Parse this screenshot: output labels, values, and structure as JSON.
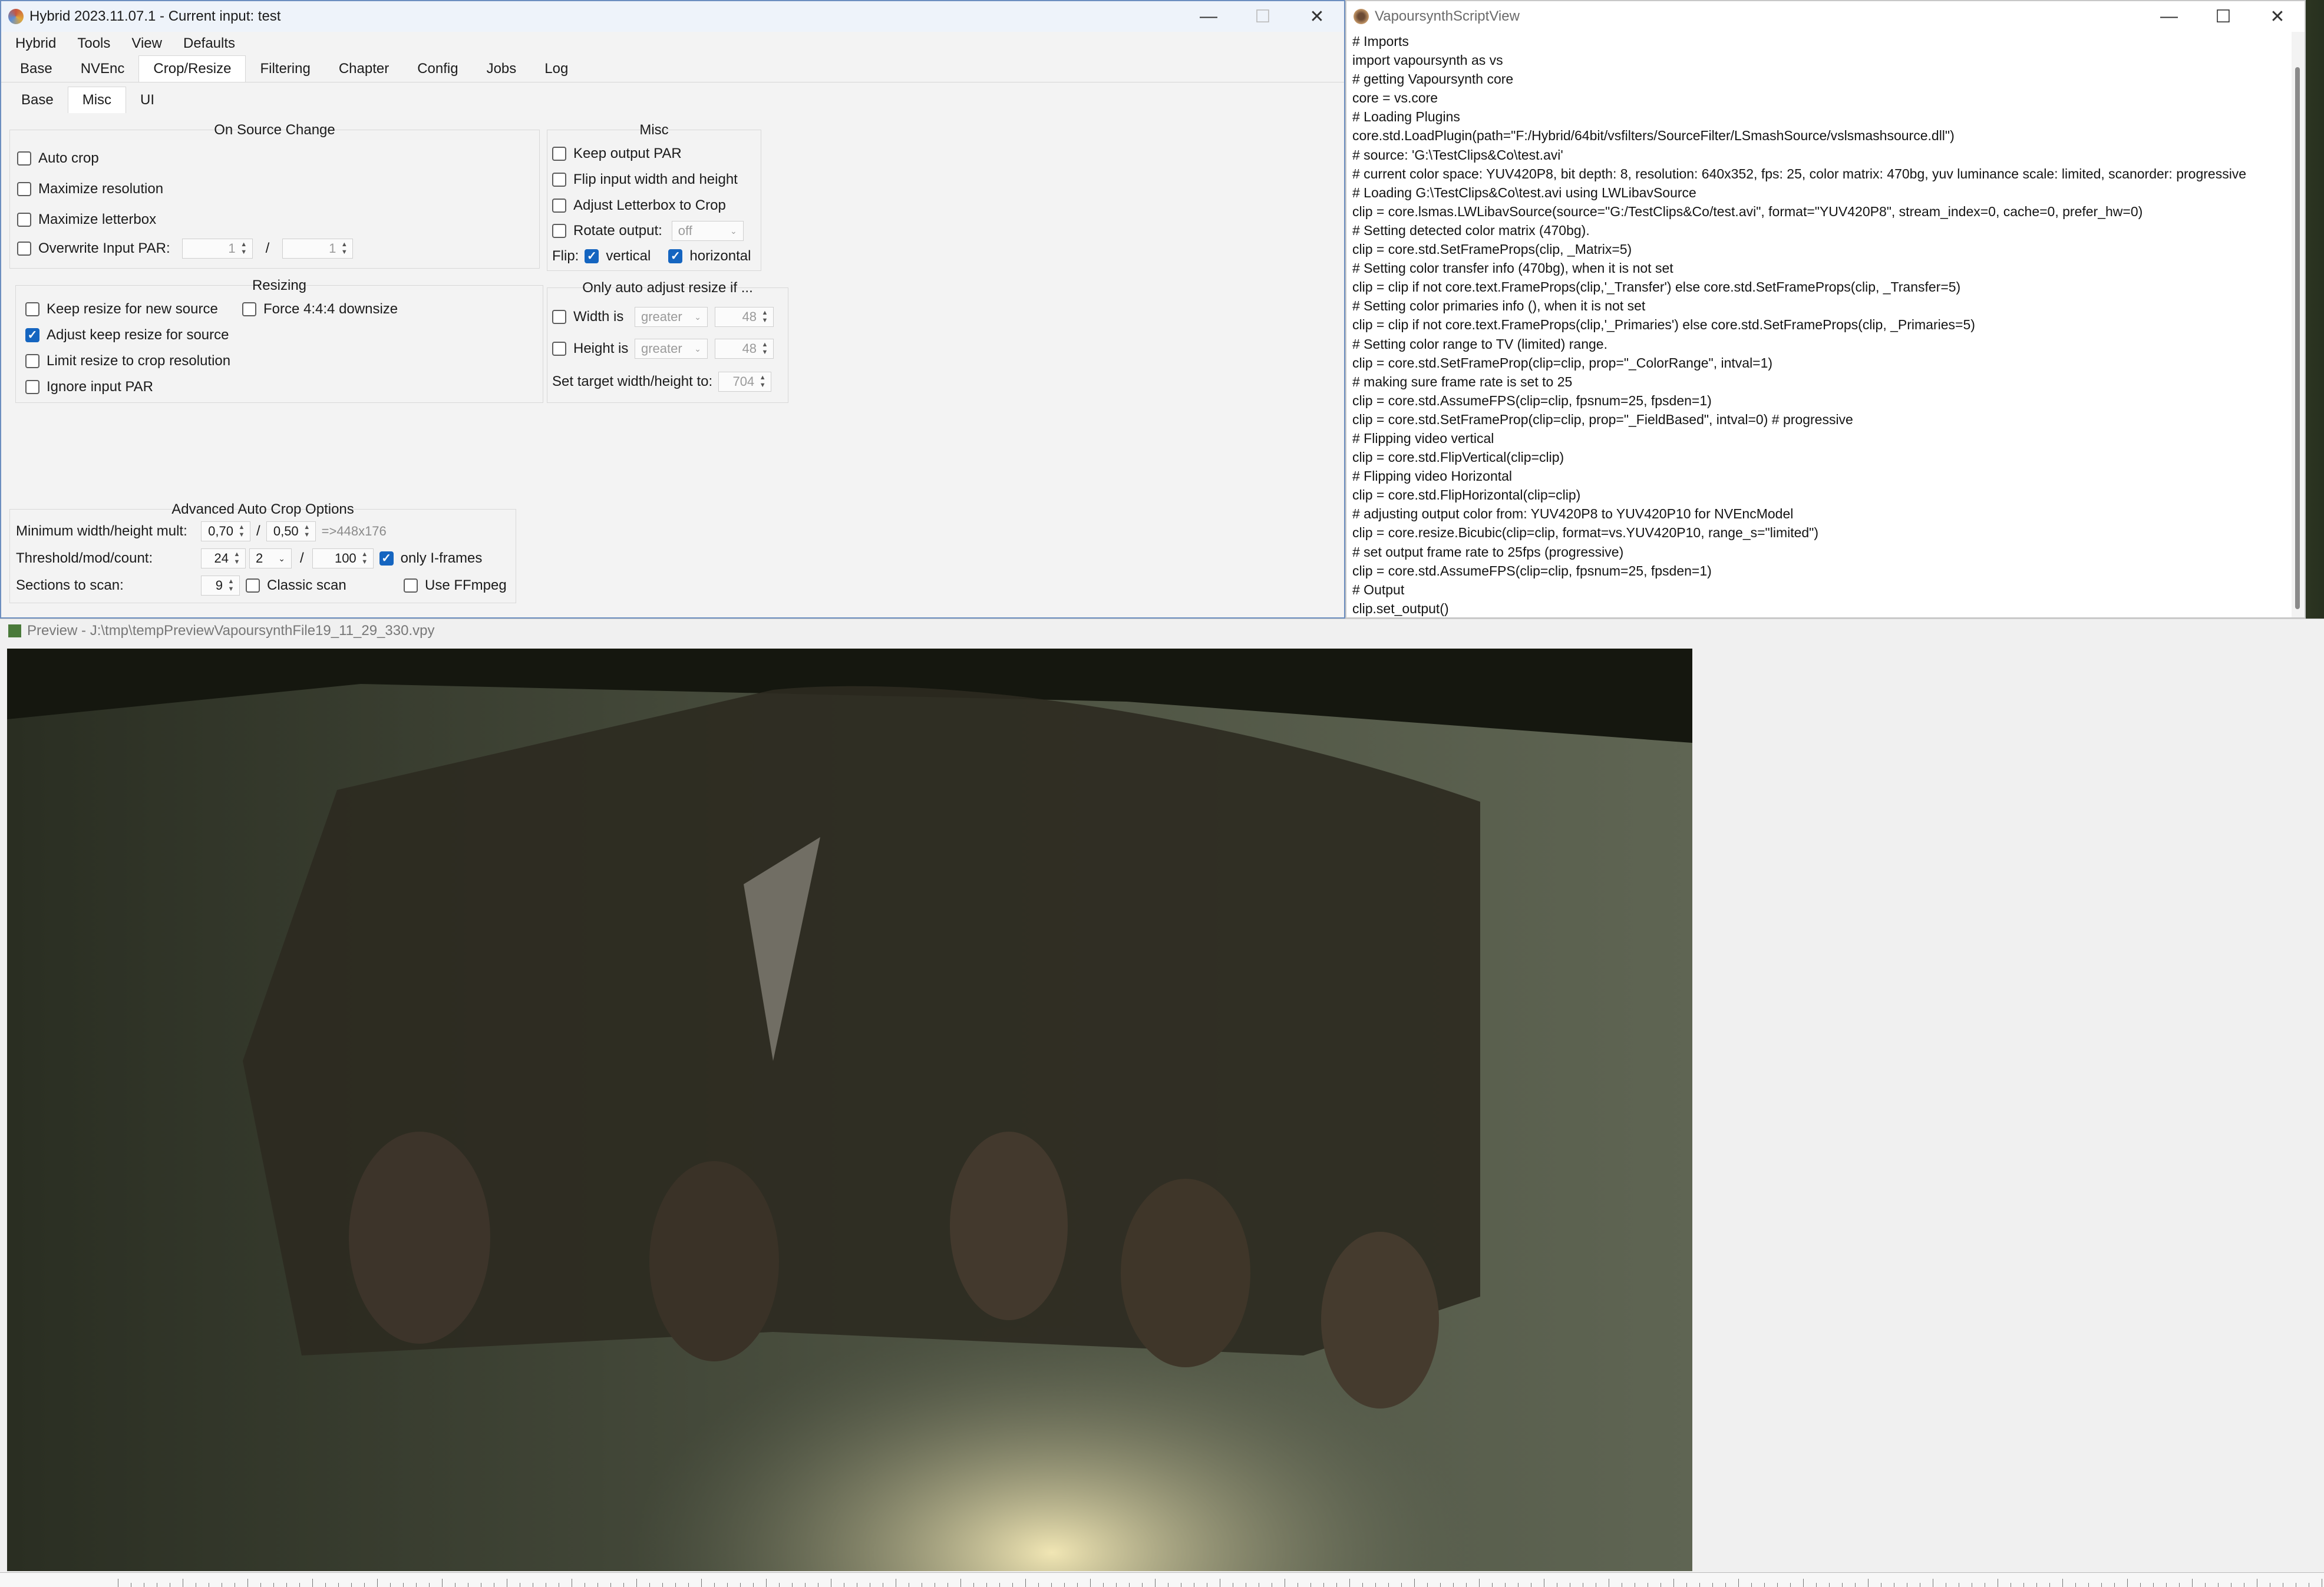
{
  "hybrid": {
    "title": "Hybrid 2023.11.07.1 - Current input: test",
    "menu": [
      "Hybrid",
      "Tools",
      "View",
      "Defaults"
    ],
    "tabs": [
      "Base",
      "NVEnc",
      "Crop/Resize",
      "Filtering",
      "Chapter",
      "Config",
      "Jobs",
      "Log"
    ],
    "active_tab": "Crop/Resize",
    "subtabs": [
      "Base",
      "Misc",
      "UI"
    ],
    "active_subtab": "Misc",
    "on_source_change": {
      "title": "On Source Change",
      "auto_crop": "Auto crop",
      "maximize_resolution": "Maximize resolution",
      "maximize_letterbox": "Maximize letterbox",
      "overwrite_par": "Overwrite Input PAR:",
      "par_num": "1",
      "par_sep": "/",
      "par_den": "1"
    },
    "misc": {
      "title": "Misc",
      "keep_output_par": "Keep output PAR",
      "flip_input": "Flip input width and height",
      "adjust_letterbox": "Adjust Letterbox to Crop",
      "rotate_output": "Rotate output:",
      "rotate_value": "off",
      "flip_label": "Flip:",
      "vertical": "vertical",
      "horizontal": "horizontal"
    },
    "resizing": {
      "title": "Resizing",
      "keep_resize": "Keep resize for new source",
      "force_444": "Force 4:4:4 downsize",
      "adjust_keep_resize": "Adjust keep resize for source",
      "limit_resize": "Limit resize to crop resolution",
      "ignore_par": "Ignore input PAR"
    },
    "auto_adjust": {
      "title": "Only auto adjust resize if ...",
      "width_is": "Width is",
      "height_is": "Height is",
      "width_cmp": "greater",
      "height_cmp": "greater",
      "width_val": "48",
      "height_val": "48",
      "set_target": "Set target width/height to:",
      "target_val": "704"
    },
    "advanced": {
      "title": "Advanced Auto Crop Options",
      "min_mult": "Minimum width/height mult:",
      "mult_w": "0,70",
      "mult_sep": "/",
      "mult_h": "0,50",
      "mult_result": "=>448x176",
      "threshold": "Threshold/mod/count:",
      "thr_val": "24",
      "thr_sep": "/",
      "mod_val": "2",
      "count_sep": "/",
      "count_val": "100",
      "only_iframes": "only I-frames",
      "sections": "Sections to scan:",
      "sections_val": "9",
      "classic_scan": "Classic scan",
      "use_ffmpeg": "Use FFmpeg"
    }
  },
  "script_view": {
    "title": "VapoursynthScriptView",
    "lines": [
      "# Imports",
      "import vapoursynth as vs",
      "# getting Vapoursynth core",
      "core = vs.core",
      "# Loading Plugins",
      "core.std.LoadPlugin(path=\"F:/Hybrid/64bit/vsfilters/SourceFilter/LSmashSource/vslsmashsource.dll\")",
      "# source: 'G:\\TestClips&Co\\test.avi'",
      "# current color space: YUV420P8, bit depth: 8, resolution: 640x352, fps: 25, color matrix: 470bg, yuv luminance scale: limited, scanorder: progressive",
      "# Loading G:\\TestClips&Co\\test.avi using LWLibavSource",
      "clip = core.lsmas.LWLibavSource(source=\"G:/TestClips&Co/test.avi\", format=\"YUV420P8\", stream_index=0, cache=0, prefer_hw=0)",
      "# Setting detected color matrix (470bg).",
      "clip = core.std.SetFrameProps(clip, _Matrix=5)",
      "# Setting color transfer info (470bg), when it is not set",
      "clip = clip if not core.text.FrameProps(clip,'_Transfer') else core.std.SetFrameProps(clip, _Transfer=5)",
      "# Setting color primaries info (), when it is not set",
      "clip = clip if not core.text.FrameProps(clip,'_Primaries') else core.std.SetFrameProps(clip, _Primaries=5)",
      "# Setting color range to TV (limited) range.",
      "clip = core.std.SetFrameProp(clip=clip, prop=\"_ColorRange\", intval=1)",
      "# making sure frame rate is set to 25",
      "clip = core.std.AssumeFPS(clip=clip, fpsnum=25, fpsden=1)",
      "clip = core.std.SetFrameProp(clip=clip, prop=\"_FieldBased\", intval=0) # progressive",
      "# Flipping video vertical",
      "clip = core.std.FlipVertical(clip=clip)",
      "# Flipping video Horizontal",
      "clip = core.std.FlipHorizontal(clip=clip)",
      "# adjusting output color from: YUV420P8 to YUV420P10 for NVEncModel",
      "clip = core.resize.Bicubic(clip=clip, format=vs.YUV420P10, range_s=\"limited\")",
      "# set output frame rate to 25fps (progressive)",
      "clip = core.std.AssumeFPS(clip=clip, fpsnum=25, fpsden=1)",
      "# Output",
      "clip.set_output()"
    ]
  },
  "preview": {
    "title": "Preview - J:\\tmp\\tempPreviewVapoursynthFile19_11_29_330.vpy"
  },
  "window_controls": {
    "minimize": "—",
    "maximize": "☐",
    "close": "✕"
  }
}
